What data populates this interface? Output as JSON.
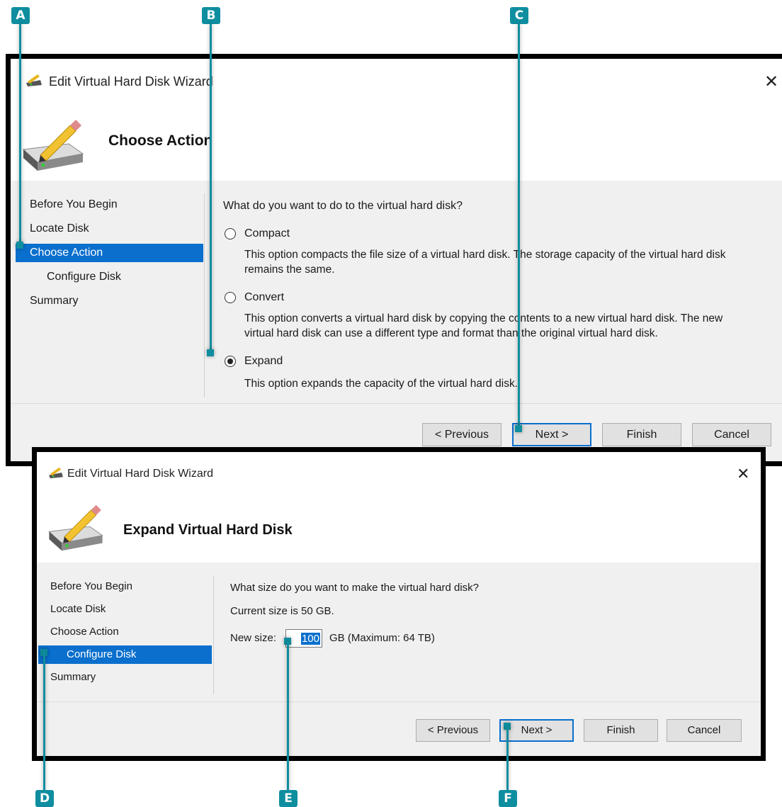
{
  "window_title": "Edit Virtual Hard Disk Wizard",
  "callouts": [
    "A",
    "B",
    "C",
    "D",
    "E",
    "F"
  ],
  "dialog1": {
    "header_title": "Choose Action",
    "nav_items": [
      "Before You Begin",
      "Locate Disk",
      "Choose Action",
      "Configure Disk",
      "Summary"
    ],
    "active_nav": "Choose Action",
    "question": "What do you want to do to the virtual hard disk?",
    "options": [
      {
        "label": "Compact",
        "description_line1": "This option compacts the file size of a virtual hard disk. The storage capacity of the virtual hard disk",
        "description_line2": "remains the same.",
        "selected": false
      },
      {
        "label": "Convert",
        "description_line1": "This option converts a virtual hard disk by copying the contents to a new virtual hard disk. The new",
        "description_line2": "virtual hard disk can use a different type and format than the original virtual hard disk.",
        "selected": false
      },
      {
        "label": "Expand",
        "description_line1": "This option expands the capacity of the virtual hard disk.",
        "description_line2": "",
        "selected": true
      }
    ],
    "buttons": {
      "previous": "< Previous",
      "next": "Next >",
      "finish": "Finish",
      "cancel": "Cancel"
    }
  },
  "dialog2": {
    "header_title": "Expand Virtual Hard Disk",
    "nav_items": [
      "Before You Begin",
      "Locate Disk",
      "Choose Action",
      "Configure Disk",
      "Summary"
    ],
    "active_nav": "Configure Disk",
    "question": "What size do you want to make the virtual hard disk?",
    "current_size": "Current size is 50 GB.",
    "new_size_label": "New size:",
    "new_size_value": "100",
    "size_unit": "GB (Maximum: 64 TB)",
    "buttons": {
      "previous": "< Previous",
      "next": "Next >",
      "finish": "Finish",
      "cancel": "Cancel"
    }
  },
  "colors": {
    "accent": "#0a6fcd",
    "callout": "#0f8ea0",
    "dialog_border": "#000000",
    "body_bg": "#f0f0f0"
  }
}
